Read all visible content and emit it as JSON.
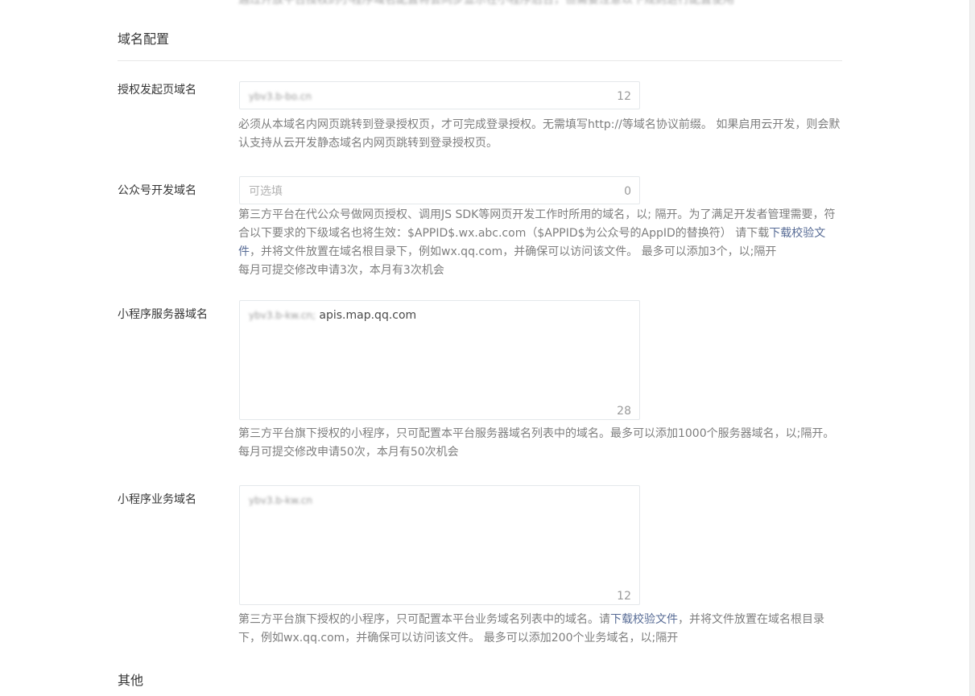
{
  "top_cut_text": "通过开放平台授权的小程序域名配置将会同步显示在小程序后台，但需要注意以下规则进行配置使用",
  "section_domain": {
    "title": "域名配置"
  },
  "auth_domain": {
    "label": "授权发起页域名",
    "value": "ybv3.b-bo.cn",
    "counter": "12",
    "desc": "必须从本域名内网页跳转到登录授权页，才可完成登录授权。无需填写http://等域名协议前缀。 如果启用云开发，则会默认支持从云开发静态域名内网页跳转到登录授权页。"
  },
  "mp_domain": {
    "label": "公众号开发域名",
    "placeholder": "可选填",
    "counter": "0",
    "desc_part1": "第三方平台在代公众号做网页授权、调用JS SDK等网页开发工作时所用的域名，以; 隔开。为了满足开发者管理需要，符合以下要求的下级域名也将生效：$APPID$.wx.abc.com（$APPID$为公众号的AppID的替换符） 请下载",
    "desc_link": "下载校验文件",
    "desc_part2": "，并将文件放置在域名根目录下，例如wx.qq.com，并确保可以访问该文件。 最多可以添加3个，以;隔开",
    "desc_line2": "每月可提交修改申请3次，本月有3次机会"
  },
  "server_domain": {
    "label": "小程序服务器域名",
    "value_blurred": "ybv3.b-kw.cn;",
    "value_clear": "apis.map.qq.com",
    "counter": "28",
    "desc": "第三方平台旗下授权的小程序，只可配置本平台服务器域名列表中的域名。最多可以添加1000个服务器域名，以;隔开。",
    "desc_line2": "每月可提交修改申请50次，本月有50次机会"
  },
  "business_domain": {
    "label": "小程序业务域名",
    "value": "ybv3.b-kw.cn",
    "counter": "12",
    "desc_part1": "第三方平台旗下授权的小程序，只可配置本平台业务域名列表中的域名。请",
    "desc_link": "下载校验文件",
    "desc_part2": "，并将文件放置在域名根目录下，例如wx.qq.com，并确保可以访问该文件。 最多可以添加200个业务域名，以;隔开"
  },
  "section_other": {
    "title": "其他"
  }
}
